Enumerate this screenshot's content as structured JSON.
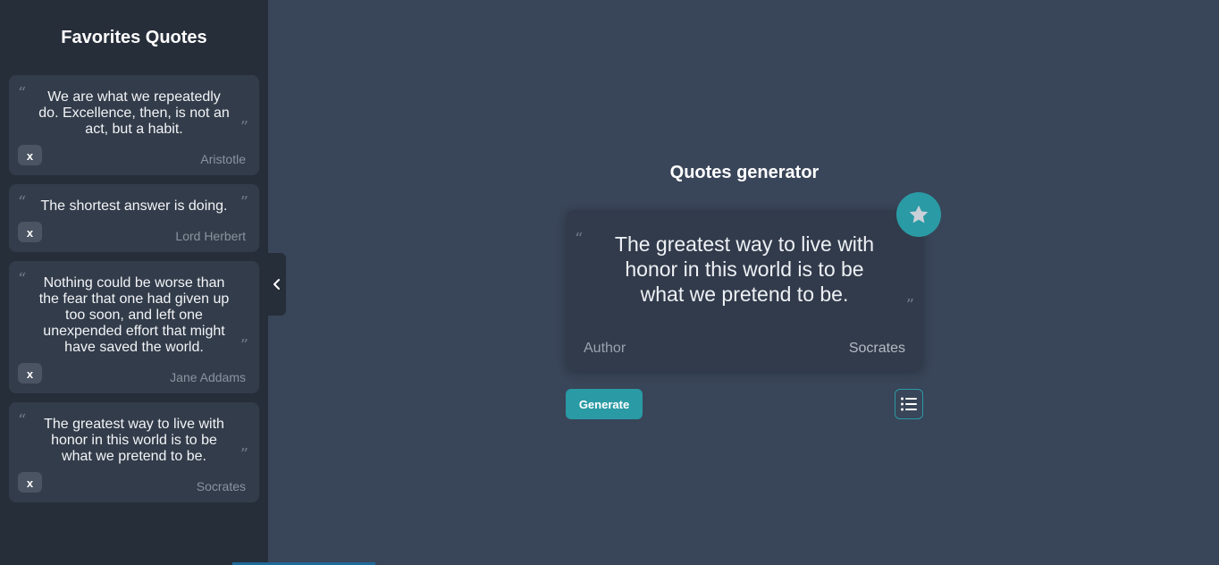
{
  "sidebar": {
    "title": "Favorites Quotes",
    "remove_label": "x",
    "items": [
      {
        "text": "We are what we repeatedly do. Excellence, then, is not an act, but a habit.",
        "author": "Aristotle"
      },
      {
        "text": "The shortest answer is doing.",
        "author": "Lord Herbert"
      },
      {
        "text": "Nothing could be worse than the fear that one had given up too soon, and left one unexpended effort that might have saved the world.",
        "author": "Jane Addams"
      },
      {
        "text": "The greatest way to live with honor in this world is to be what we pretend to be.",
        "author": "Socrates"
      }
    ]
  },
  "main": {
    "title": "Quotes generator",
    "quote_text": "The greatest way to live with honor in this world is to be what we pretend to be.",
    "author_label": "Author",
    "author_name": "Socrates",
    "generate_label": "Generate"
  },
  "icons": {
    "favorite": "star-icon",
    "list": "list-icon",
    "collapse": "chevron-left-icon",
    "quote_open": "open-quote-icon",
    "quote_close": "close-quote-icon"
  },
  "colors": {
    "accent": "#2a9aa5",
    "sidebar_bg": "#262e3a",
    "main_bg": "#394558",
    "card_bg": "#333c4a"
  }
}
